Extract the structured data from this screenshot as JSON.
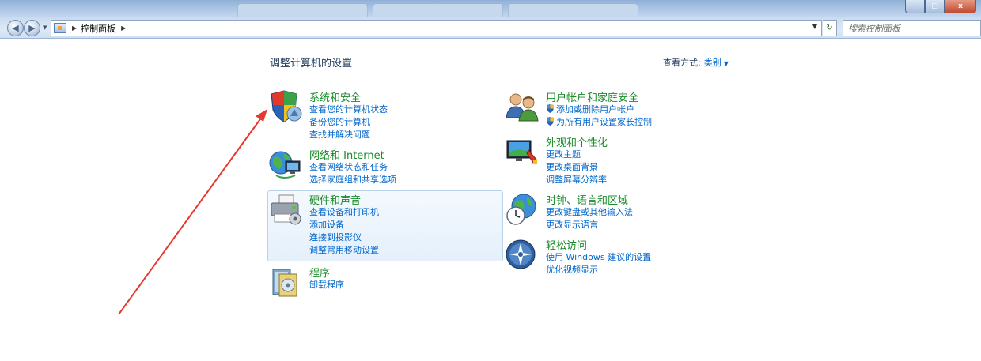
{
  "window": {
    "controls": {
      "min": "_",
      "max": "□",
      "close": "x"
    }
  },
  "nav": {
    "breadcrumb": "控制面板",
    "search_placeholder": "搜索控制面板"
  },
  "header": {
    "title": "调整计算机的设置",
    "view_label": "查看方式:",
    "view_value": "类别"
  },
  "categories": [
    {
      "id": "system-security",
      "title": "系统和安全",
      "links": [
        "查看您的计算机状态",
        "备份您的计算机",
        "查找并解决问题"
      ]
    },
    {
      "id": "network",
      "title": "网络和 Internet",
      "links": [
        "查看网络状态和任务",
        "选择家庭组和共享选项"
      ]
    },
    {
      "id": "hardware",
      "title": "硬件和声音",
      "links": [
        "查看设备和打印机",
        "添加设备",
        "连接到投影仪",
        "调整常用移动设置"
      ]
    },
    {
      "id": "programs",
      "title": "程序",
      "links": [
        "卸载程序"
      ]
    },
    {
      "id": "user-accounts",
      "title": "用户帐户和家庭安全",
      "links": [
        "添加或删除用户帐户",
        "为所有用户设置家长控制"
      ]
    },
    {
      "id": "appearance",
      "title": "外观和个性化",
      "links": [
        "更改主题",
        "更改桌面背景",
        "调整屏幕分辨率"
      ]
    },
    {
      "id": "clock-region",
      "title": "时钟、语言和区域",
      "links": [
        "更改键盘或其他输入法",
        "更改显示语言"
      ]
    },
    {
      "id": "ease-access",
      "title": "轻松访问",
      "links": [
        "使用 Windows 建议的设置",
        "优化视频显示"
      ]
    }
  ],
  "colors": {
    "category_title": "#1a8a2a",
    "link": "#0066cc",
    "annotation_arrow": "#e8372c"
  }
}
